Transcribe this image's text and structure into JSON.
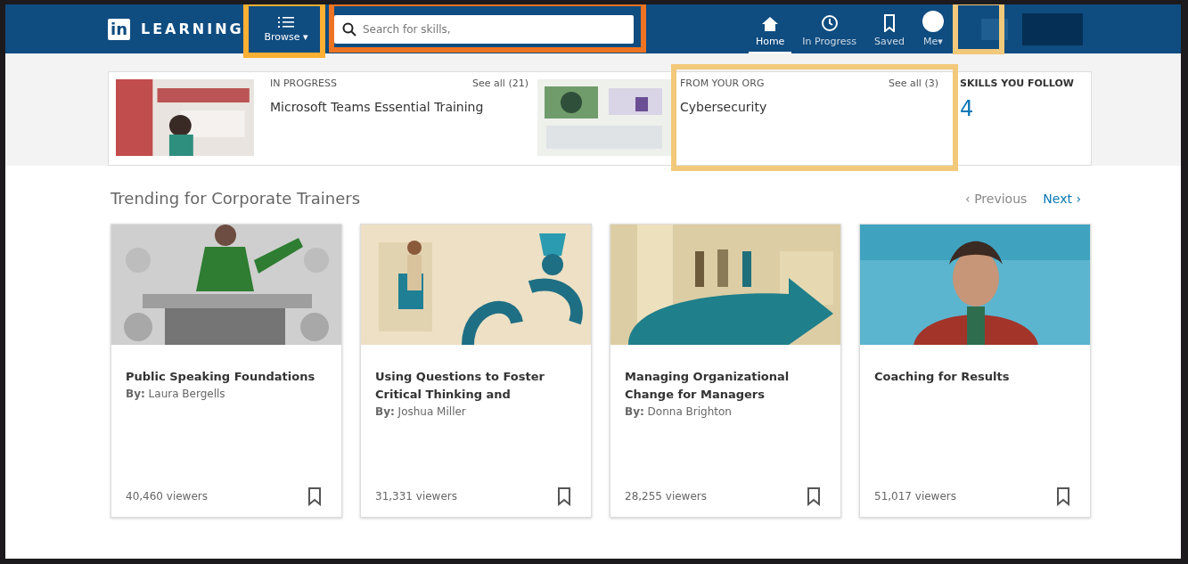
{
  "header": {
    "logo_mark": "in",
    "logo_text": "LEARNING",
    "browse": "Browse",
    "browse_caret": "▾",
    "search": {
      "placeholder": "Search for skills,"
    },
    "nav": [
      {
        "label": "Home",
        "selected": true
      },
      {
        "label": "In Progress",
        "selected": false
      },
      {
        "label": "Saved",
        "selected": false
      },
      {
        "label": "Me",
        "caret": "▾",
        "selected": false
      }
    ]
  },
  "summary": {
    "in_progress": {
      "title": "IN PROGRESS",
      "see_all": "See all (21)",
      "course": "Microsoft Teams Essential Training"
    },
    "org": {
      "title": "FROM YOUR ORG",
      "see_all": "See all (3)",
      "course": "Cybersecurity"
    },
    "skills": {
      "title": "SKILLS YOU FOLLOW",
      "count": "4"
    }
  },
  "trending": {
    "title": "Trending for Corporate Trainers",
    "previous_arrow": "‹",
    "previous": "Previous",
    "next": "Next",
    "next_arrow": "›",
    "cards": [
      {
        "title": "Public Speaking Foundations",
        "by": "By:",
        "author": "Laura Bergells",
        "viewers": "40,460 viewers"
      },
      {
        "title": "Using Questions to Foster Critical Thinking and",
        "by": "By:",
        "author": "Joshua Miller",
        "viewers": "31,331 viewers"
      },
      {
        "title": "Managing Organizational Change for Managers",
        "by": "By:",
        "author": "Donna Brighton",
        "viewers": "28,255 viewers"
      },
      {
        "title": "Coaching for Results",
        "viewers": "51,017 viewers"
      }
    ]
  }
}
